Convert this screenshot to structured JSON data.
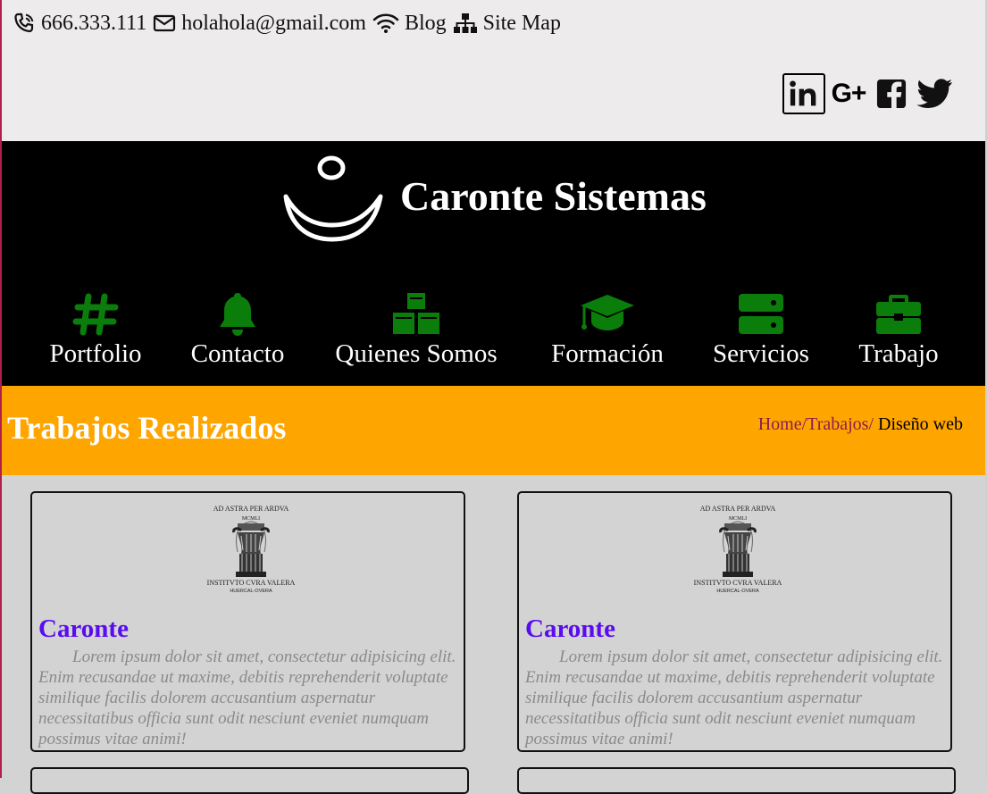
{
  "topbar": {
    "phone": "666.333.111",
    "email": "holahola@gmail.com",
    "blog": "Blog",
    "sitemap": "Site Map",
    "social": [
      "linkedin-icon",
      "google-plus-icon",
      "facebook-icon",
      "twitter-icon"
    ]
  },
  "header": {
    "brand": "Caronte Sistemas",
    "nav": [
      {
        "label": "Portfolio",
        "icon": "hashtag-icon"
      },
      {
        "label": "Contacto",
        "icon": "bell-icon"
      },
      {
        "label": "Quienes Somos",
        "icon": "cubes-icon"
      },
      {
        "label": "Formación",
        "icon": "graduation-cap-icon"
      },
      {
        "label": "Servicios",
        "icon": "server-icon"
      },
      {
        "label": "Trabajo",
        "icon": "briefcase-icon"
      }
    ]
  },
  "banner": {
    "title": "Trabajos Realizados",
    "crumb_home": "Home",
    "crumb_trabajos": "/Trabajos/",
    "crumb_current": " Diseño web"
  },
  "cards": [
    {
      "title": "Caronte",
      "text": "Lorem ipsum dolor sit amet, consectetur adipisicing elit. Enim recusandae ut maxime, debitis reprehenderit voluptate similique facilis dolorem accusantium aspernatur necessitatibus officia sunt odit nesciunt eveniet numquam possimus vitae animi!"
    },
    {
      "title": "Caronte",
      "text": "Lorem ipsum dolor sit amet, consectetur adipisicing elit. Enim recusandae ut maxime, debitis reprehenderit voluptate similique facilis dolorem accusantium aspernatur necessitatibus officia sunt odit nesciunt eveniet numquam possimus vitae animi!"
    }
  ],
  "seal": {
    "top_text": "AD ASTRA PER ARDVA",
    "year": "MCMLI",
    "bottom_text": "INSTITVTO CVRA VALERA",
    "town": "HUERCAL-OVERA"
  },
  "colors": {
    "accent_green": "#0a7d0a",
    "banner": "#ffa500",
    "card_title": "#5a0cf0",
    "breadcrumb_link": "#8b1d50"
  }
}
